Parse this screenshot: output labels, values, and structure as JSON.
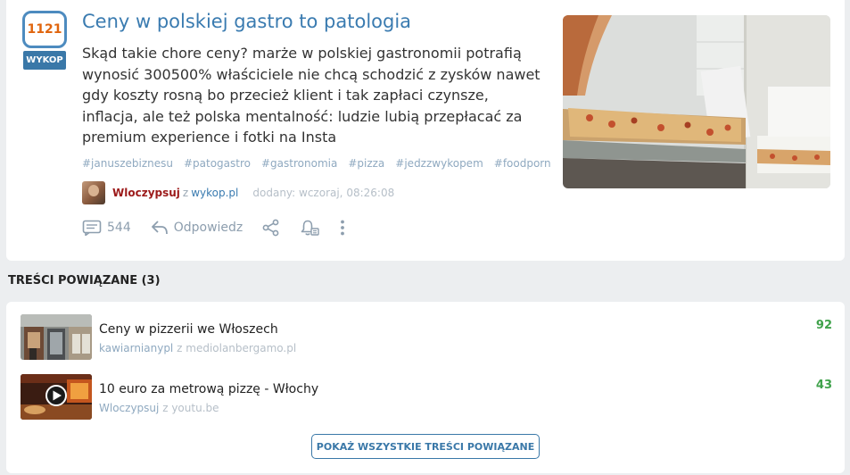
{
  "entry": {
    "votes": "1121",
    "vote_button": "WYKOP",
    "title": "Ceny w polskiej gastro to patologia",
    "description": "Skąd takie chore ceny? marże w polskiej gastronomii potrafią wynosić 300500% właściciele nie chcą schodzić z zysków nawet gdy koszty rosną bo przecież klient i tak zapłaci czynsze, inflacja, ale też polska mentalność: ludzie lubią przepłacać za premium experience i fotki na Insta",
    "tags": [
      "#januszebiznesu",
      "#patogastro",
      "#gastronomia",
      "#pizza",
      "#jedzzwykopem",
      "#foodporn"
    ],
    "author": "Wloczypsuj",
    "from_word": "z",
    "source": "wykop.pl",
    "added": "dodany: wczoraj, 08:26:08",
    "comments_count": "544",
    "reply_label": "Odpowiedz",
    "icons": {
      "comments": "comments-icon",
      "reply": "reply-icon",
      "share": "share-icon",
      "notify": "bell-icon",
      "more": "more-vertical-icon"
    }
  },
  "related": {
    "title": "TREŚCI POWIĄZANE (3)",
    "items": [
      {
        "title": "Ceny w pizzerii we Włoszech",
        "author": "kawiarnianypl",
        "from_word": "z",
        "source": "mediolanbergamo.pl",
        "score": "92"
      },
      {
        "title": "10 euro za metrową pizzę - Włochy",
        "author": "Wloczypsuj",
        "from_word": "z",
        "source": "youtu.be",
        "score": "43"
      }
    ],
    "show_all": "POKAŻ WSZYSTKIE TREŚCI POWIĄZANE"
  },
  "colors": {
    "accent": "#3a78a8",
    "title": "#3a7bb0",
    "vote_count": "#e0650e",
    "author": "#9c1a1a",
    "score": "#3fa24b"
  }
}
